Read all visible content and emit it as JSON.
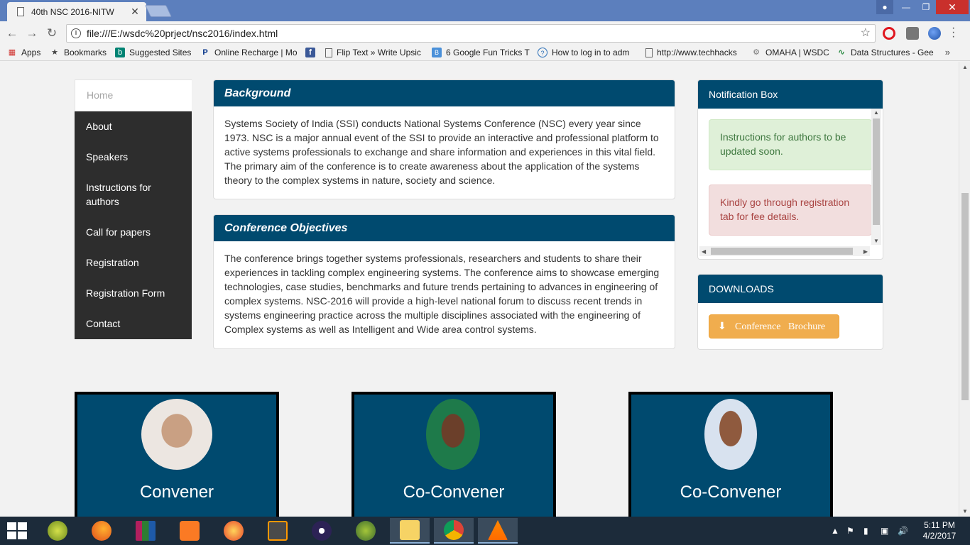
{
  "browser": {
    "tab_title": "40th NSC 2016-NITW",
    "tab_close": "✕",
    "url": "file:///E:/wsdc%20prject/nsc2016/index.html",
    "bookmarks": [
      {
        "label": "Apps",
        "icon": "apps-grid-icon"
      },
      {
        "label": "Bookmarks",
        "icon": "star-icon"
      },
      {
        "label": "Suggested Sites",
        "icon": "bing-icon"
      },
      {
        "label": "Online Recharge | Mo",
        "icon": "paypal-icon"
      },
      {
        "label": "",
        "icon": "facebook-icon"
      },
      {
        "label": "Flip Text » Write Upsic",
        "icon": "page-icon"
      },
      {
        "label": "6 Google Fun Tricks T",
        "icon": "blogger-icon"
      },
      {
        "label": "How to log in to adm",
        "icon": "help-icon"
      },
      {
        "label": "http://www.techhacks",
        "icon": "page-icon"
      },
      {
        "label": "OMAHA | WSDC",
        "icon": "omaha-icon"
      },
      {
        "label": "Data Structures - Gee",
        "icon": "geeks-icon"
      }
    ],
    "bookmarks_more": "»"
  },
  "sidebar": {
    "items": [
      {
        "label": "Home",
        "active": true
      },
      {
        "label": "About"
      },
      {
        "label": "Speakers"
      },
      {
        "label": "Instructions for authors"
      },
      {
        "label": "Call for papers"
      },
      {
        "label": "Registration"
      },
      {
        "label": "Registration Form"
      },
      {
        "label": "Contact"
      }
    ]
  },
  "background_panel": {
    "title": "Background",
    "body": "Systems Society of India (SSI) conducts National Systems Conference (NSC) every year since 1973. NSC is a major annual event of the SSI to provide an interactive and professional platform to active systems professionals to exchange and share information and experiences in this vital field. The primary aim of the conference is to create awareness about the application of the systems theory to the complex systems in nature, society and science."
  },
  "objectives_panel": {
    "title": "Conference Objectives",
    "body": "The conference brings together systems professionals, researchers and students to share their experiences in tackling complex engineering systems. The conference aims to showcase emerging technologies, case studies, benchmarks and future trends pertaining to advances in engineering of complex systems. NSC-2016 will provide a high-level national forum to discuss recent trends in systems engineering practice across the multiple disciplines associated with the engineering of Complex systems as well as Intelligent and Wide area control systems."
  },
  "notification_box": {
    "title": "Notification Box",
    "alerts": [
      {
        "text": "Instructions for authors to be updated soon.",
        "type": "success"
      },
      {
        "text": "Kindly go through registration tab for fee details.",
        "type": "danger"
      }
    ]
  },
  "downloads": {
    "title": "DOWNLOADS",
    "button_label": "Conference   Brochure",
    "button_icon": "download-icon"
  },
  "cards": [
    {
      "role": "Convener"
    },
    {
      "role": "Co-Convener"
    },
    {
      "role": "Co-Convener"
    }
  ],
  "taskbar": {
    "time": "5:11 PM",
    "date": "4/2/2017"
  },
  "colors": {
    "primary": "#004a6f",
    "sidebar": "#2d2d2d",
    "warning_button": "#f0ad4e",
    "alert_success_bg": "#dff0d8",
    "alert_danger_bg": "#f2dede",
    "chrome_frame": "#5c7fbd"
  }
}
